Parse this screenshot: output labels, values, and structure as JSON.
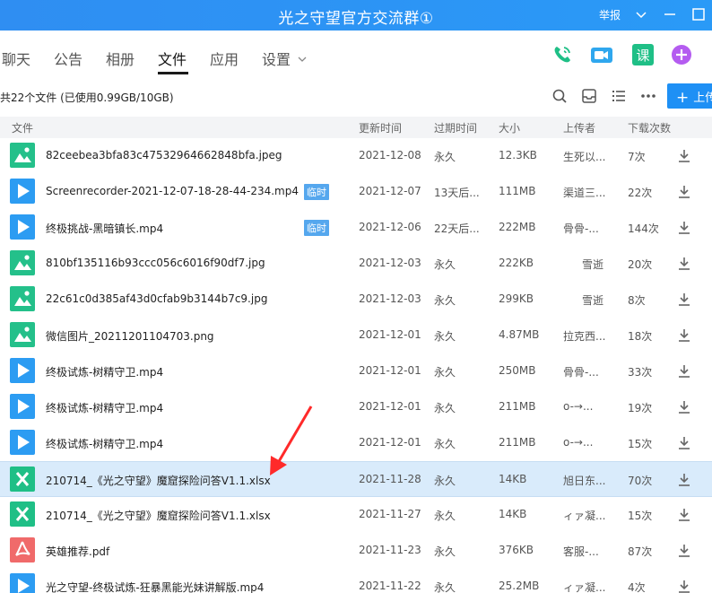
{
  "window": {
    "title": "光之守望官方交流群①",
    "report_label": "举报"
  },
  "tabs": [
    {
      "label": "聊天"
    },
    {
      "label": "公告"
    },
    {
      "label": "相册"
    },
    {
      "label": "文件"
    },
    {
      "label": "应用"
    },
    {
      "label": "设置"
    }
  ],
  "active_tab": "文件",
  "toolbar": {
    "summary": "共22个文件 (已使用0.99GB/10GB)",
    "upload_label": "上传",
    "icons": [
      "search-icon",
      "inbox-icon",
      "list-view-icon",
      "more-icon"
    ]
  },
  "header_icons": [
    "phone-icon",
    "video-call-icon",
    "lesson-icon",
    "add-app-icon"
  ],
  "columns": {
    "file": "文件",
    "updated": "更新时间",
    "expire": "过期时间",
    "size": "大小",
    "uploader": "上传者",
    "downloads": "下载次数"
  },
  "files": [
    {
      "type": "image",
      "name": "82ceebea3bfa83c47532964662848bfa.jpeg",
      "badge": "",
      "updated": "2021-12-08",
      "expire": "永久",
      "size": "12.3KB",
      "uploader": "生死以...",
      "downloads": "7次"
    },
    {
      "type": "video",
      "name": "Screenrecorder-2021-12-07-18-28-44-234.mp4",
      "badge": "临时",
      "updated": "2021-12-07",
      "expire": "13天后...",
      "size": "111MB",
      "uploader": "渠道三...",
      "downloads": "22次"
    },
    {
      "type": "video",
      "name": "终极挑战-黑暗镇长.mp4",
      "badge": "临时",
      "updated": "2021-12-06",
      "expire": "22天后...",
      "size": "222MB",
      "uploader": "骨骨-...",
      "downloads": "144次"
    },
    {
      "type": "image",
      "name": "810bf135116b93ccc056c6016f90df7.jpg",
      "badge": "",
      "updated": "2021-12-03",
      "expire": "永久",
      "size": "222KB",
      "uploader": "雪逝",
      "downloads": "20次"
    },
    {
      "type": "image",
      "name": "22c61c0d385af43d0cfab9b3144b7c9.jpg",
      "badge": "",
      "updated": "2021-12-03",
      "expire": "永久",
      "size": "299KB",
      "uploader": "雪逝",
      "downloads": "8次"
    },
    {
      "type": "image",
      "name": "微信图片_20211201104703.png",
      "badge": "",
      "updated": "2021-12-01",
      "expire": "永久",
      "size": "4.87MB",
      "uploader": "拉克西...",
      "downloads": "18次"
    },
    {
      "type": "video",
      "name": "终极试炼-树精守卫.mp4",
      "badge": "",
      "updated": "2021-12-01",
      "expire": "永久",
      "size": "250MB",
      "uploader": "骨骨-...",
      "downloads": "33次"
    },
    {
      "type": "video",
      "name": "终极试炼-树精守卫.mp4",
      "badge": "",
      "updated": "2021-12-01",
      "expire": "永久",
      "size": "211MB",
      "uploader": "o-→...",
      "downloads": "19次"
    },
    {
      "type": "video",
      "name": "终极试炼-树精守卫.mp4",
      "badge": "",
      "updated": "2021-12-01",
      "expire": "永久",
      "size": "211MB",
      "uploader": "o-→...",
      "downloads": "15次"
    },
    {
      "type": "xlsx",
      "name": "210714_《光之守望》魔窟探险问答V1.1.xlsx",
      "badge": "",
      "updated": "2021-11-28",
      "expire": "永久",
      "size": "14KB",
      "uploader": "旭日东...",
      "downloads": "70次"
    },
    {
      "type": "xlsx",
      "name": "210714_《光之守望》魔窟探险问答V1.1.xlsx",
      "badge": "",
      "updated": "2021-11-27",
      "expire": "永久",
      "size": "14KB",
      "uploader": "ィァ凝...",
      "downloads": "15次"
    },
    {
      "type": "pdf",
      "name": "英雄推荐.pdf",
      "badge": "",
      "updated": "2021-11-23",
      "expire": "永久",
      "size": "376KB",
      "uploader": "客服-...",
      "downloads": "87次"
    },
    {
      "type": "video",
      "name": "光之守望-终极试炼-狂暴黑能光妹讲解版.mp4",
      "badge": "",
      "updated": "2021-11-22",
      "expire": "永久",
      "size": "25.2MB",
      "uploader": "ィァ凝...",
      "downloads": "4次"
    }
  ],
  "selected_file": "210714_《光之守望》魔窟探险问答V1.1.xlsx",
  "colors": {
    "titlebar": "#2f8ef2",
    "accent": "#1e90f5",
    "selected_row": "#d9ebfb",
    "arrow": "#ff2a2a"
  }
}
